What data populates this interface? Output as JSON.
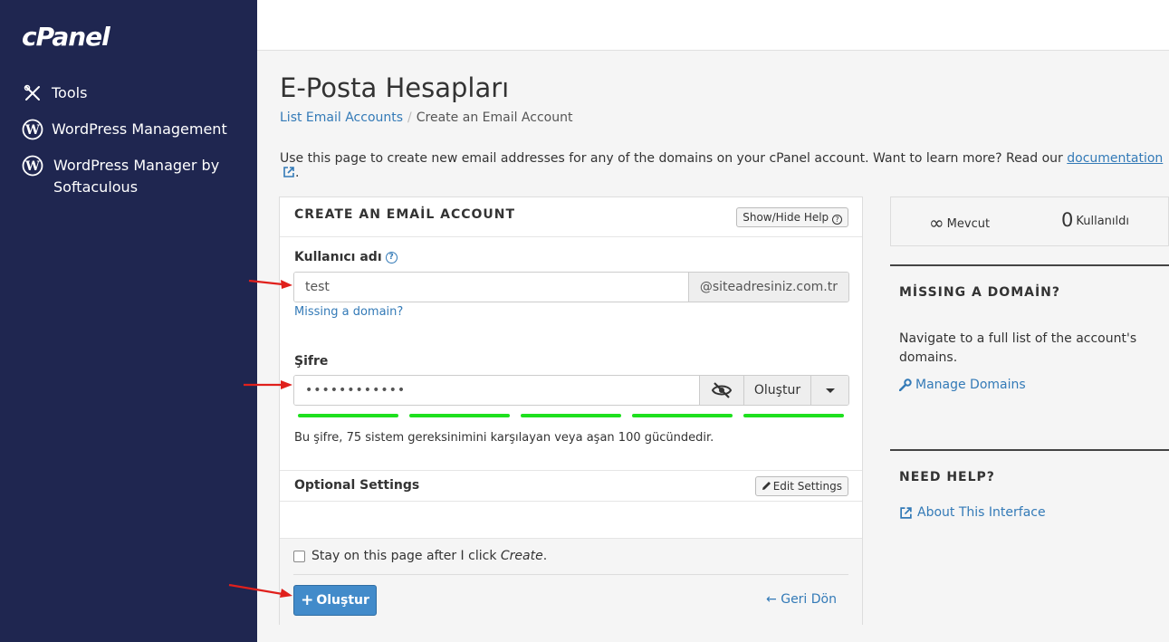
{
  "sidebar": {
    "logo": "cPanel",
    "items": [
      {
        "label": "Tools",
        "icon": "tools-icon"
      },
      {
        "label": "WordPress Management",
        "icon": "wordpress-icon"
      },
      {
        "label": "WordPress Manager by Softaculous",
        "icon": "wordpress-icon"
      }
    ]
  },
  "page": {
    "title": "E-Posta Hesapları",
    "breadcrumb": {
      "parent": "List Email Accounts",
      "current": "Create an Email Account"
    },
    "intro_text": "Use this page to create new email addresses for any of the domains on your cPanel account. Want to learn more? Read our",
    "intro_link": "documentation",
    "intro_end": "."
  },
  "form": {
    "title": "CREATE AN EMAİL ACCOUNT",
    "help_button": "Show/Hide Help",
    "username_label": "Kullanıcı adı",
    "username_value": "test",
    "domain": "@siteadresiniz.com.tr",
    "missing_domain_link": "Missing a domain?",
    "password_label": "Şifre",
    "password_value": "••••••••••••",
    "generate_button": "Oluştur",
    "strength_text": "Bu şifre, 75 sistem gereksinimini karşılayan veya aşan 100 gücündedir.",
    "optional_title": "Optional Settings",
    "edit_settings_button": "Edit Settings",
    "stay_label": "Stay on this page after I click",
    "stay_label_em": "Create",
    "stay_label_end": ".",
    "create_button": "Oluştur",
    "back_link": "Geri Dön"
  },
  "stats": {
    "available_value": "∞",
    "available_label": "Mevcut",
    "used_value": "0",
    "used_label": "Kullanıldı"
  },
  "missing_domain": {
    "title": "MİSSING A DOMAİN?",
    "description": "Navigate to a full list of the account's domains.",
    "link": "Manage Domains"
  },
  "need_help": {
    "title": "NEED HELP?",
    "link": "About This Interface"
  },
  "colors": {
    "sidebar": "#1f2650",
    "accent": "#428bca",
    "link": "#337ab7",
    "strength": "#1ee01e",
    "arrow": "#e0201c"
  }
}
